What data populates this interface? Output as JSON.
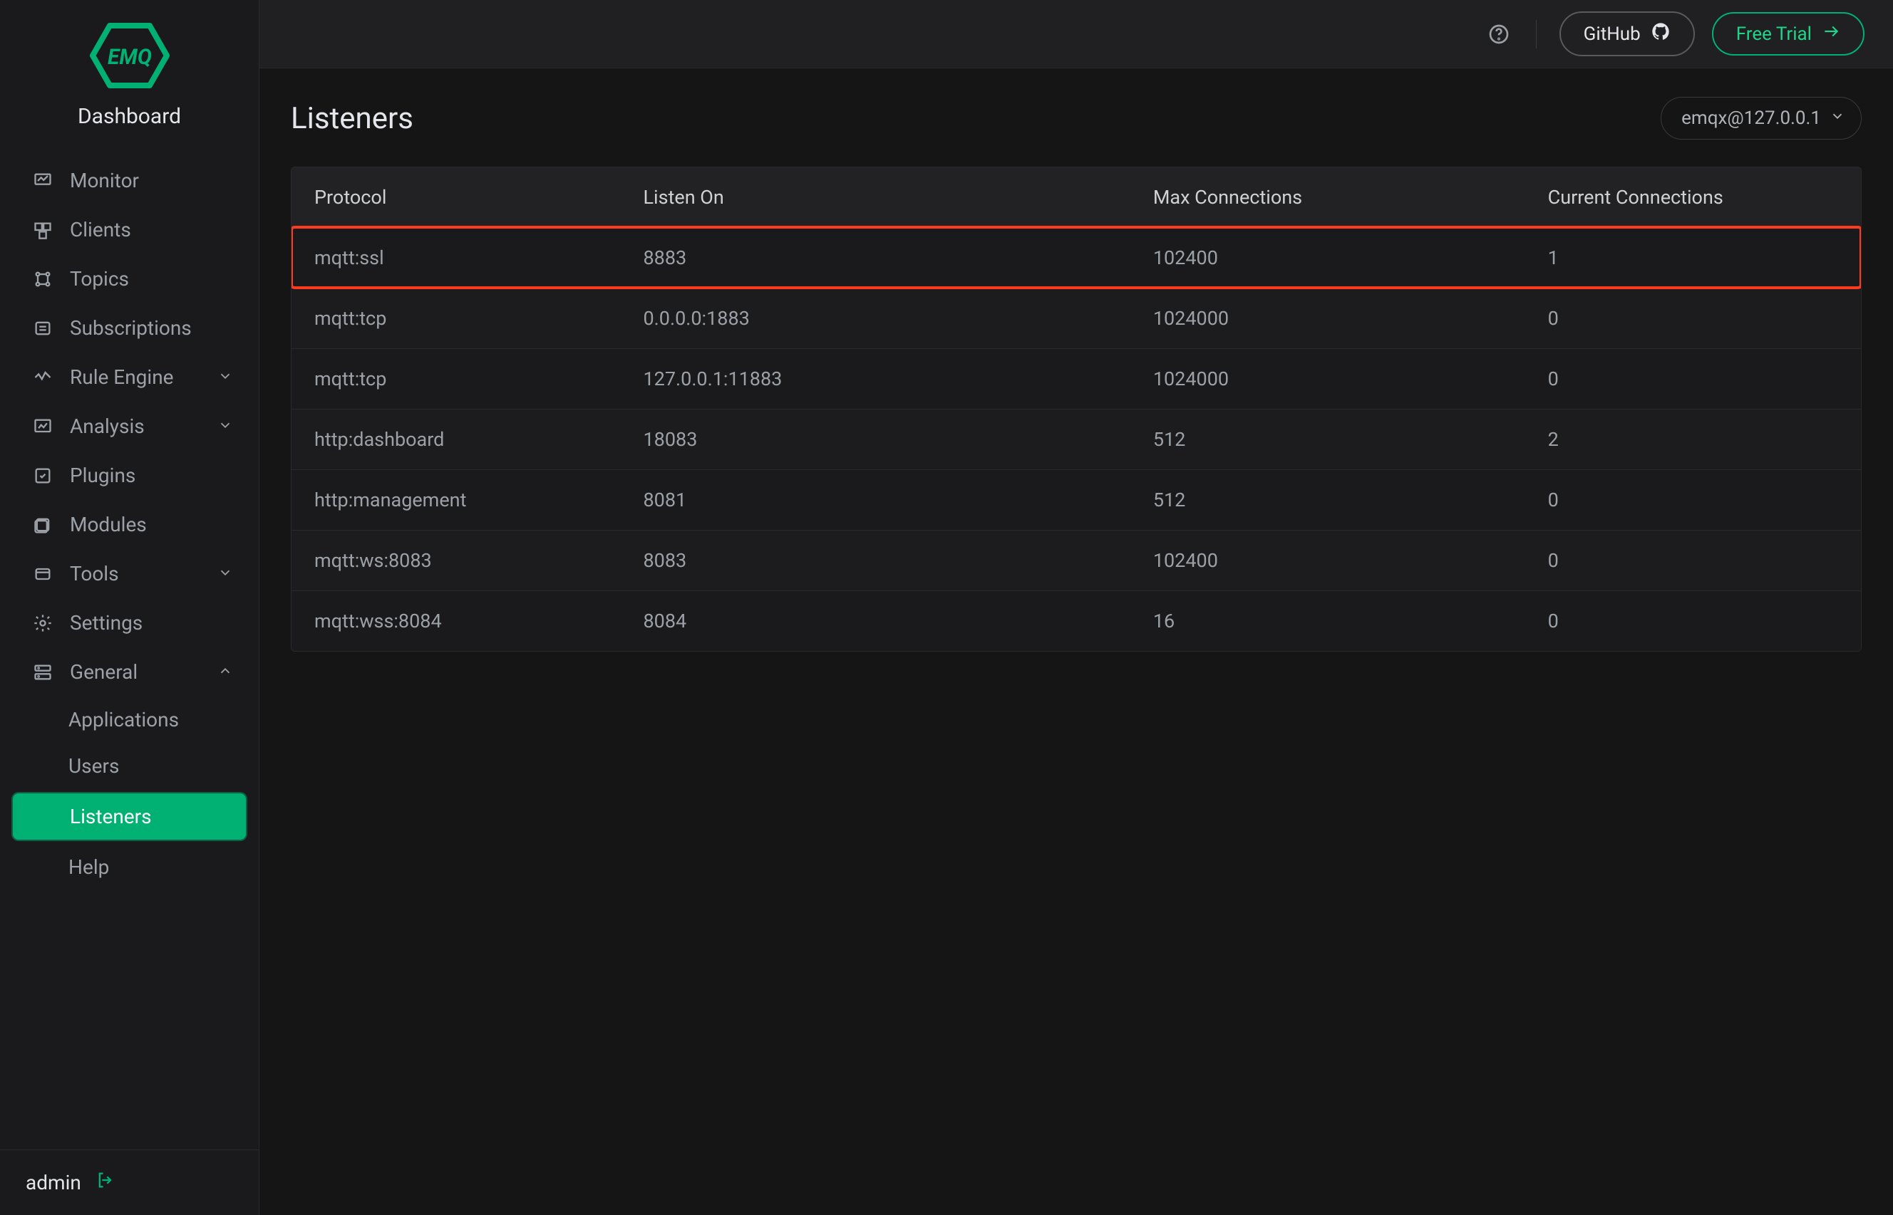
{
  "brand": {
    "logo_text": "EMQ",
    "title": "Dashboard"
  },
  "topbar": {
    "github_label": "GitHub",
    "trial_label": "Free Trial"
  },
  "page": {
    "title": "Listeners",
    "node_selected": "emqx@127.0.0.1"
  },
  "sidebar": {
    "items": [
      {
        "label": "Monitor",
        "icon": "monitor-icon"
      },
      {
        "label": "Clients",
        "icon": "clients-icon"
      },
      {
        "label": "Topics",
        "icon": "topics-icon"
      },
      {
        "label": "Subscriptions",
        "icon": "subscriptions-icon"
      },
      {
        "label": "Rule Engine",
        "icon": "rule-engine-icon",
        "expandable": true
      },
      {
        "label": "Analysis",
        "icon": "analysis-icon",
        "expandable": true
      },
      {
        "label": "Plugins",
        "icon": "plugins-icon"
      },
      {
        "label": "Modules",
        "icon": "modules-icon"
      },
      {
        "label": "Tools",
        "icon": "tools-icon",
        "expandable": true
      },
      {
        "label": "Settings",
        "icon": "settings-icon"
      },
      {
        "label": "General",
        "icon": "general-icon",
        "expandable": true,
        "expanded": true
      }
    ],
    "general_sub": [
      {
        "label": "Applications"
      },
      {
        "label": "Users"
      },
      {
        "label": "Listeners",
        "active": true
      },
      {
        "label": "Help"
      }
    ]
  },
  "bottom": {
    "username": "admin"
  },
  "table": {
    "columns": [
      "Protocol",
      "Listen On",
      "Max Connections",
      "Current Connections"
    ],
    "rows": [
      {
        "protocol": "mqtt:ssl",
        "listen_on": "8883",
        "max": "102400",
        "current": "1",
        "highlight": true
      },
      {
        "protocol": "mqtt:tcp",
        "listen_on": "0.0.0.0:1883",
        "max": "1024000",
        "current": "0"
      },
      {
        "protocol": "mqtt:tcp",
        "listen_on": "127.0.0.1:11883",
        "max": "1024000",
        "current": "0"
      },
      {
        "protocol": "http:dashboard",
        "listen_on": "18083",
        "max": "512",
        "current": "2"
      },
      {
        "protocol": "http:management",
        "listen_on": "8081",
        "max": "512",
        "current": "0"
      },
      {
        "protocol": "mqtt:ws:8083",
        "listen_on": "8083",
        "max": "102400",
        "current": "0"
      },
      {
        "protocol": "mqtt:wss:8084",
        "listen_on": "8084",
        "max": "16",
        "current": "0"
      }
    ]
  }
}
